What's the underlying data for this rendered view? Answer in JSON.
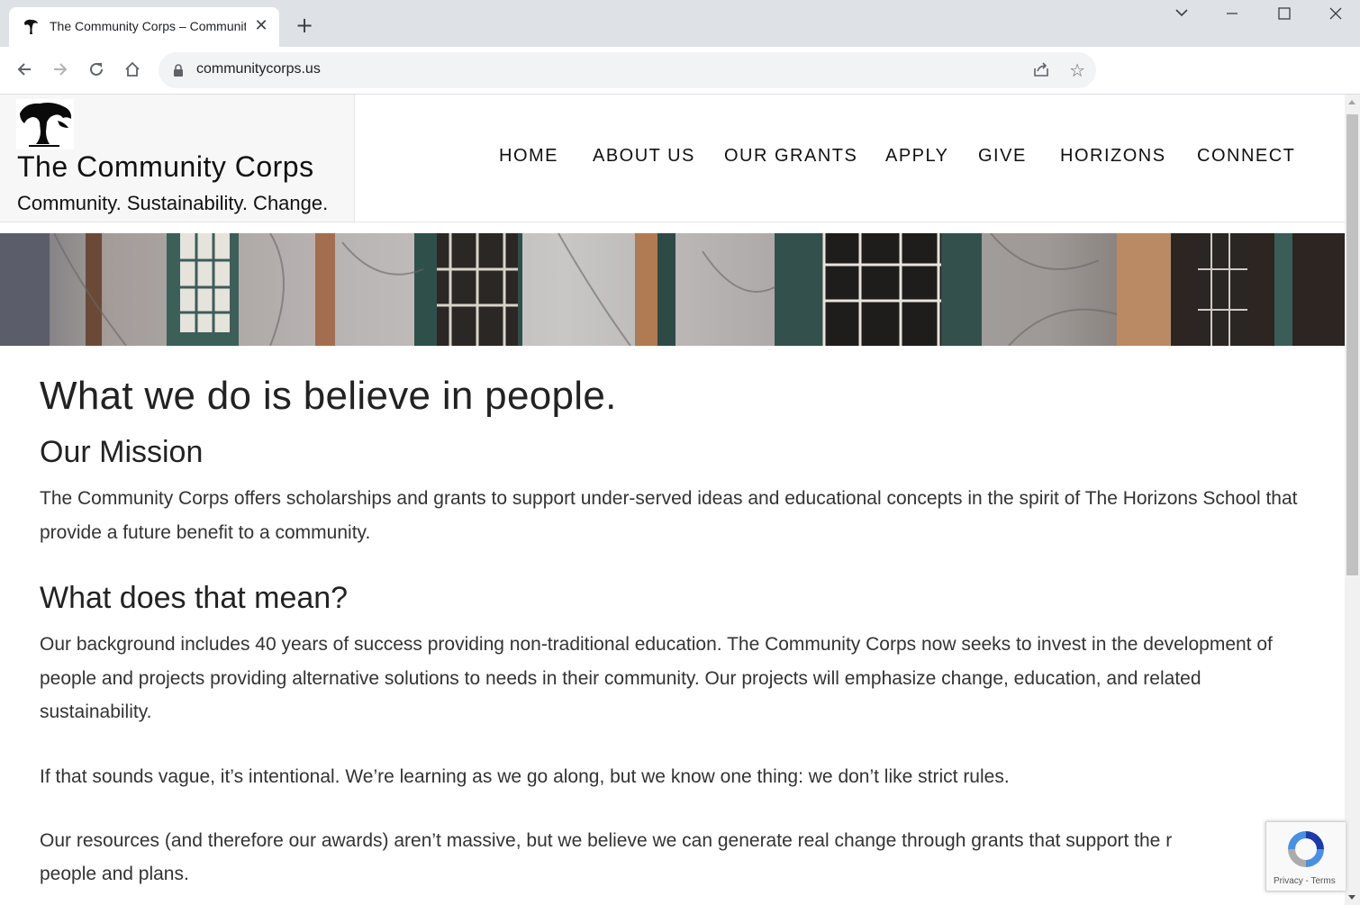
{
  "browser": {
    "tab_title": "The Community Corps – Community",
    "url": "communitycorps.us",
    "icons": [
      "back-icon",
      "forward-icon",
      "reload-icon",
      "home-icon",
      "lock-icon",
      "share-icon",
      "star-icon",
      "close-icon",
      "new-tab-icon",
      "tab-search-icon",
      "minimize-icon",
      "maximize-icon",
      "window-close-icon"
    ]
  },
  "site": {
    "title": "The Community Corps",
    "tagline": "Community. Sustainability. Change."
  },
  "nav": {
    "items": [
      "HOME",
      "ABOUT US",
      "OUR GRANTS",
      "APPLY",
      "GIVE",
      "HORIZONS",
      "CONNECT"
    ]
  },
  "content": {
    "headline": "What we do is believe in people.",
    "mission_heading": "Our Mission",
    "mission_text": "The Community Corps offers scholarships and grants to support under-served ideas and educational concepts in the spirit of The Horizons School that provide a future benefit to a community.",
    "meaning_heading": "What does that mean?",
    "meaning_p1": "Our background includes 40 years of success providing non-traditional education. The Community Corps now seeks to invest in the development of people and projects providing alternative solutions to needs in their community. Our projects will emphasize change, education, and related sustainability.",
    "meaning_p2": "If that sounds vague, it’s intentional. We’re learning as we go along, but we know one thing: we don’t like strict rules.",
    "meaning_p3": "Our resources (and therefore our awards) aren’t massive, but we believe we can generate real change through grants that support the r",
    "meaning_p3_cont": "people and plans."
  },
  "recaptcha": {
    "links": "Privacy - Terms"
  },
  "colors": {
    "chrome_bg": "#dee1e6",
    "omnibox_bg": "#f1f3f4",
    "branding_bg": "#f7f7f7",
    "text": "#333333"
  }
}
